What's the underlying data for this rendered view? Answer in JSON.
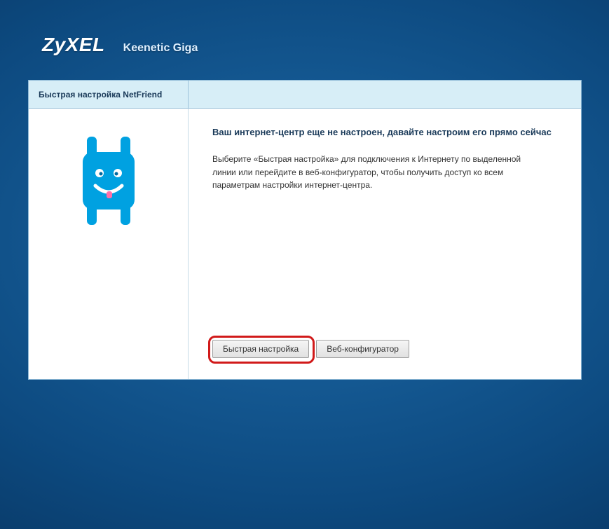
{
  "header": {
    "brand": "ZyXEL",
    "model": "Keenetic Giga"
  },
  "tab": {
    "label": "Быстрая настройка NetFriend"
  },
  "content": {
    "heading": "Ваш интернет-центр еще не настроен, давайте настроим его прямо сейчас",
    "paragraph": "Выберите «Быстрая настройка» для подключения к Интернету по выделенной линии или перейдите в веб-конфигуратор, чтобы получить доступ ко всем параметрам настройки интернет-центра."
  },
  "buttons": {
    "quick_setup": "Быстрая настройка",
    "web_config": "Веб-конфигуратор"
  },
  "colors": {
    "accent": "#00a1e1",
    "highlight": "#d11a1a"
  }
}
